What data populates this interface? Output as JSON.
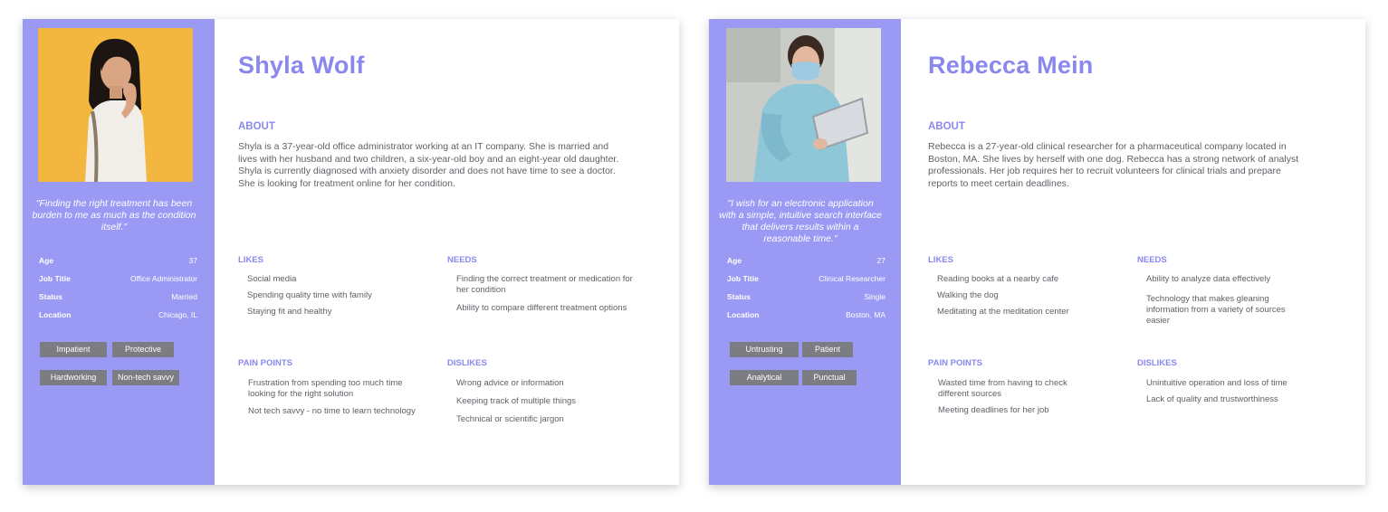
{
  "personas": [
    {
      "name": "Shyla Wolf",
      "quote": "\"Finding the right treatment has been burden to me as much as the condition itself.\"",
      "attributes": [
        {
          "key": "Age",
          "value": "37"
        },
        {
          "key": "Job Title",
          "value": "Office Administrator"
        },
        {
          "key": "Status",
          "value": "Married"
        },
        {
          "key": "Location",
          "value": "Chicago, IL"
        }
      ],
      "traits": [
        "Impatient",
        "Protective",
        "Hardworking",
        "Non-tech savvy"
      ],
      "about_title": "ABOUT",
      "about": "Shyla is a 37-year-old office administrator working at an IT company. She is married and lives with her husband and two children, a six-year-old boy and an eight-year old daughter. Shyla is currently diagnosed with anxiety disorder and does not have time to see a doctor. She is looking for treatment online for her condition.",
      "likes_title": "LIKES",
      "likes": [
        "Social media",
        "Spending quality time with family",
        "Staying fit and healthy"
      ],
      "needs_title": "NEEDS",
      "needs": [
        "Finding the correct treatment or medication for her condition",
        "Ability to compare different treatment options"
      ],
      "pain_title": "PAIN POINTS",
      "pain_points": [
        "Frustration from spending too much time looking for the right solution",
        "Not tech savvy - no time to learn technology"
      ],
      "dislikes_title": "DISLIKES",
      "dislikes": [
        "Wrong advice or information",
        "Keeping track of multiple things",
        "Technical or scientific jargon"
      ]
    },
    {
      "name": "Rebecca Mein",
      "quote": "\"I wish for an electronic application with a simple, intuitive search interface that delivers results within a reasonable time.\"",
      "attributes": [
        {
          "key": "Age",
          "value": "27"
        },
        {
          "key": "Job Title",
          "value": "Clinical Researcher"
        },
        {
          "key": "Status",
          "value": "Single"
        },
        {
          "key": "Location",
          "value": "Boston, MA"
        }
      ],
      "traits": [
        "Untrusting",
        "Patient",
        "Analytical",
        "Punctual"
      ],
      "about_title": "ABOUT",
      "about": "Rebecca is a 27-year-old clinical researcher for a pharmaceutical company located in Boston, MA. She lives by herself with one dog. Rebecca has a strong network of analyst professionals. Her job requires her to recruit volunteers for clinical trials and prepare reports to meet certain deadlines.",
      "likes_title": "LIKES",
      "likes": [
        "Reading books at a nearby cafe",
        "Walking the dog",
        "Meditating at the meditation center"
      ],
      "needs_title": "NEEDS",
      "needs": [
        "Ability to analyze data effectively",
        "Technology that makes gleaning information from a variety of sources easier"
      ],
      "pain_title": "PAIN POINTS",
      "pain_points": [
        "Wasted time from having to check different sources",
        "Meeting deadlines for her job"
      ],
      "dislikes_title": "DISLIKES",
      "dislikes": [
        "Unintuitive operation and loss of time",
        "Lack of quality and trustworthiness"
      ]
    }
  ],
  "colors": {
    "accent": "#9a99f4",
    "heading": "#8a88ef",
    "tag_bg": "#7c7c83",
    "body_text": "#606068"
  }
}
